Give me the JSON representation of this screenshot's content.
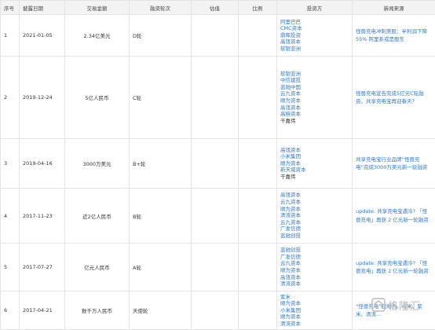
{
  "headers": [
    "序号",
    "披露日期",
    "交易金额",
    "融资轮次",
    "估值",
    "比例",
    "投资方",
    "新闻来源"
  ],
  "rows": [
    {
      "no": "1",
      "date": "2021-01-05",
      "amount": "2.34亿美元",
      "round": "D轮",
      "valuation": "",
      "ratio": "",
      "investors": [
        {
          "name": "阿里巴巴",
          "link": true
        },
        {
          "name": "CMC资本",
          "link": true
        },
        {
          "name": "鼎晖投资",
          "link": true
        },
        {
          "name": "高瓴资本",
          "link": true
        },
        {
          "name": "软银亚洲",
          "link": true
        }
      ],
      "news": "怪兽充电冲刺美股：半利润下降55% 阿里系或是股东"
    },
    {
      "no": "2",
      "date": "2019-12-24",
      "amount": "5亿人民币",
      "round": "C轮",
      "valuation": "",
      "ratio": "",
      "investors": [
        {
          "name": "软银亚洲",
          "link": true
        },
        {
          "name": "中信建投",
          "link": true
        },
        {
          "name": "蓝驰中国",
          "link": true
        },
        {
          "name": "云九资本",
          "link": true
        },
        {
          "name": "顺为资本",
          "link": true
        },
        {
          "name": "高瓴资本",
          "link": true
        },
        {
          "name": "高榕资本",
          "link": true
        },
        {
          "name": "干嘉伟",
          "link": false
        }
      ],
      "news": "怪兽充电宣告完成5亿元C轮融资，共享充电宝再迎春天？"
    },
    {
      "no": "3",
      "date": "2019-04-16",
      "amount": "3000万美元",
      "round": "B+轮",
      "valuation": "",
      "ratio": "",
      "investors": [
        {
          "name": "高瓴资本",
          "link": true
        },
        {
          "name": "小米集团",
          "link": true
        },
        {
          "name": "顺为资本",
          "link": true
        },
        {
          "name": "新天域资本",
          "link": true
        },
        {
          "name": "干嘉伟",
          "link": false
        }
      ],
      "news": "共享充电宝行业品牌“怪兽充电”完成3000万美元新一轮融资"
    },
    {
      "no": "4",
      "date": "2017-11-23",
      "amount": "近2亿人民币",
      "round": "B轮",
      "valuation": "",
      "ratio": "",
      "investors": [
        {
          "name": "高瓴资本",
          "link": true
        },
        {
          "name": "云九资本",
          "link": true
        },
        {
          "name": "顺为资本",
          "link": true
        },
        {
          "name": "清流资本",
          "link": true
        },
        {
          "name": "云九资本",
          "link": true
        },
        {
          "name": "广发信德",
          "link": true
        },
        {
          "name": "蓝驰创投",
          "link": true
        }
      ],
      "news": "update: 共享充电宝遇冷? 「怪兽充电」再获 2 亿元新一轮融资"
    },
    {
      "no": "5",
      "date": "2017-07-27",
      "amount": "亿元人民币",
      "round": "A轮",
      "valuation": "",
      "ratio": "",
      "investors": [
        {
          "name": "蓝驰创投",
          "link": true
        },
        {
          "name": "广发信德",
          "link": true
        },
        {
          "name": "云九资本",
          "link": true
        },
        {
          "name": "顺为资本",
          "link": true
        },
        {
          "name": "高瓴资本",
          "link": true
        },
        {
          "name": "清流资本",
          "link": true
        }
      ],
      "news": "update: 共享充电宝遇冷? 「怪兽充电」再获 2 亿元新一轮融资"
    },
    {
      "no": "6",
      "date": "2017-04-21",
      "amount": "数千万人民币",
      "round": "天使轮",
      "valuation": "",
      "ratio": "",
      "investors": [
        {
          "name": "紫米",
          "link": true
        },
        {
          "name": "顺为资本",
          "link": true
        },
        {
          "name": "小米集团",
          "link": true
        },
        {
          "name": "顺为资本",
          "link": true
        },
        {
          "name": "清流资本",
          "link": true
        }
      ],
      "news": "“怪兽充电”获顺为、小米、紫米、清流..."
    }
  ],
  "watermark": "格隆汇",
  "colors": {
    "link": "#2e7ad1",
    "header_bg": "#f3f3f3",
    "border": "#e4e4e4"
  }
}
